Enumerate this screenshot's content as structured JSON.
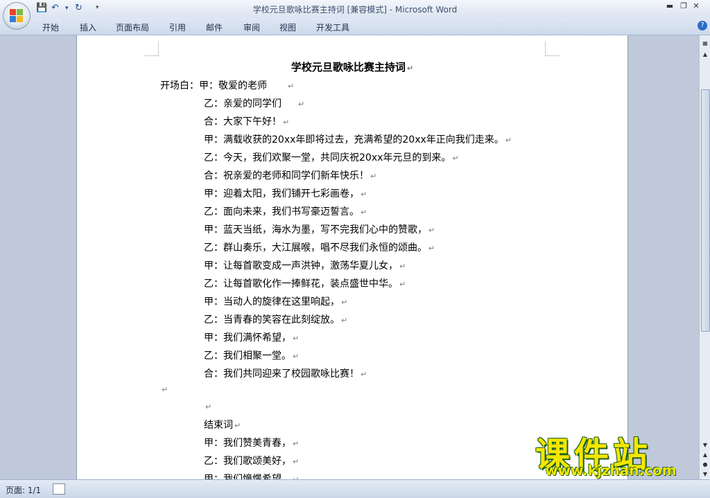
{
  "window": {
    "title": "学校元旦歌咏比赛主持词 [兼容模式] - Microsoft Word",
    "controls": [
      "minimize",
      "restore",
      "close"
    ]
  },
  "ribbon": {
    "tabs": [
      "开始",
      "插入",
      "页面布局",
      "引用",
      "邮件",
      "审阅",
      "视图",
      "开发工具"
    ]
  },
  "document": {
    "title": "学校元旦歌咏比赛主持词",
    "lines": [
      "开场白：甲：敬爱的老师",
      "乙：亲爱的同学们",
      "合：大家下午好！",
      "甲：满载收获的20xx年即将过去，充满希望的20xx年正向我们走来。",
      "乙：今天，我们欢聚一堂，共同庆祝20xx年元旦的到来。",
      "合：祝亲爱的老师和同学们新年快乐！",
      "甲：迎着太阳，我们铺开七彩画卷，",
      "乙：面向未来，我们书写豪迈誓言。",
      "甲：蓝天当纸，海水为墨，写不完我们心中的赞歌，",
      "乙：群山奏乐，大江展喉，唱不尽我们永恒的颂曲。",
      "甲：让每首歌变成一声洪钟，激荡华夏儿女，",
      "乙：让每首歌化作一捧鲜花，装点盛世中华。",
      "甲：当动人的旋律在这里响起，",
      "乙：当青春的笑容在此刻绽放。",
      "甲：我们满怀希望，",
      "乙：我们相聚一堂。",
      "合：我们共同迎来了校园歌咏比赛！",
      "",
      "",
      "结束词",
      "甲：我们赞美青春，",
      "乙：我们歌颂美好，",
      "甲：我们憧憬希望，"
    ],
    "paragraph_mark": "↵"
  },
  "status": {
    "page": "页面: 1/1"
  },
  "watermark": {
    "big": "课件站",
    "small": "www.kjzhan.com"
  }
}
